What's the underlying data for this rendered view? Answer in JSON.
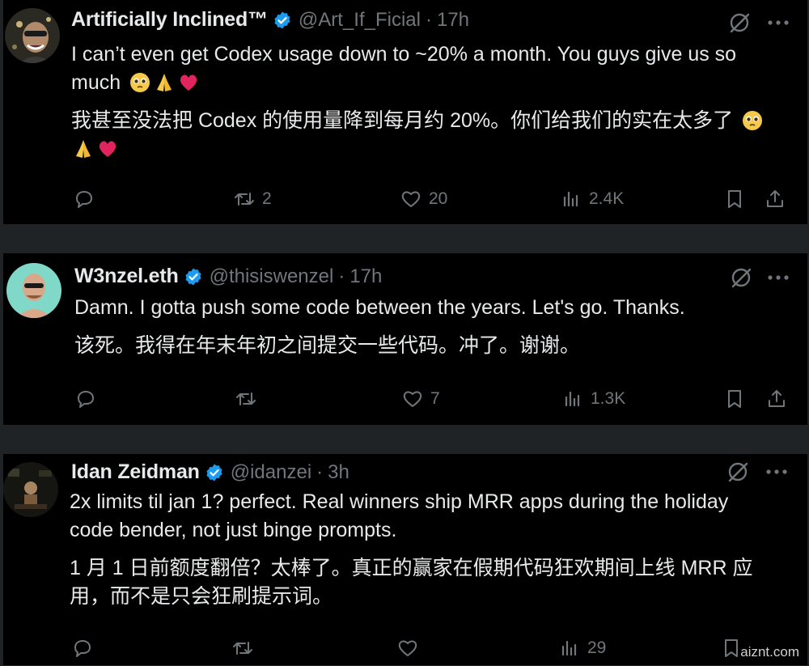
{
  "tweets": [
    {
      "name": "Artificially Inclined™",
      "handle": "@Art_If_Ficial",
      "separator": "·",
      "time": "17h",
      "verified": true,
      "text_en": "I can’t even get Codex usage down to ~20% a month. You guys give us so much",
      "text_en_line1": "I can’t even get Codex usage down to ~20% a month. You guys give us so",
      "text_en_line2": "much",
      "text_zh_line1": "我甚至没法把 Codex 的使用量降到每月约 20%。你们给我们的实在太多了",
      "text_zh_line2": "",
      "emojis": [
        "pleading-face-emoji",
        "folded-hands-emoji",
        "red-heart-emoji"
      ],
      "actions": {
        "reply": "",
        "retweet": "2",
        "like": "20",
        "views": "2.4K"
      }
    },
    {
      "name": "W3nzel.eth",
      "handle": "@thisiswenzel",
      "separator": "·",
      "time": "17h",
      "verified": true,
      "text_en_line1": "Damn. I gotta push some code between the years. Let's go.  Thanks.",
      "text_zh_line1": "该死。我得在年末年初之间提交一些代码。冲了。谢谢。",
      "actions": {
        "reply": "",
        "retweet": "",
        "like": "7",
        "views": "1.3K"
      }
    },
    {
      "name": "Idan Zeidman",
      "handle": "@idanzei",
      "separator": "·",
      "time": "3h",
      "verified": true,
      "text_en_line1": "2x limits til jan 1? perfect. Real winners ship MRR apps during the holiday",
      "text_en_line2": "code bender, not just binge prompts.",
      "text_zh_line1": "1 月 1 日前额度翻倍？太棒了。真正的赢家在假期代码狂欢期间上线 MRR 应",
      "text_zh_line2": "用，而不是只会狂刷提示词。",
      "actions": {
        "reply": "",
        "retweet": "",
        "like": "",
        "views": "29"
      }
    }
  ],
  "watermark": "aiznt.com",
  "colors": {
    "background": "#000000",
    "separator": "#202326",
    "text": "#e7e9ea",
    "muted": "#71767b",
    "verified": "#1d9bf0",
    "heart": "#e0245e"
  },
  "icons": [
    "verified-badge-icon",
    "grok-icon",
    "more-icon",
    "reply-icon",
    "retweet-icon",
    "like-icon",
    "views-icon",
    "bookmark-icon",
    "share-icon"
  ]
}
